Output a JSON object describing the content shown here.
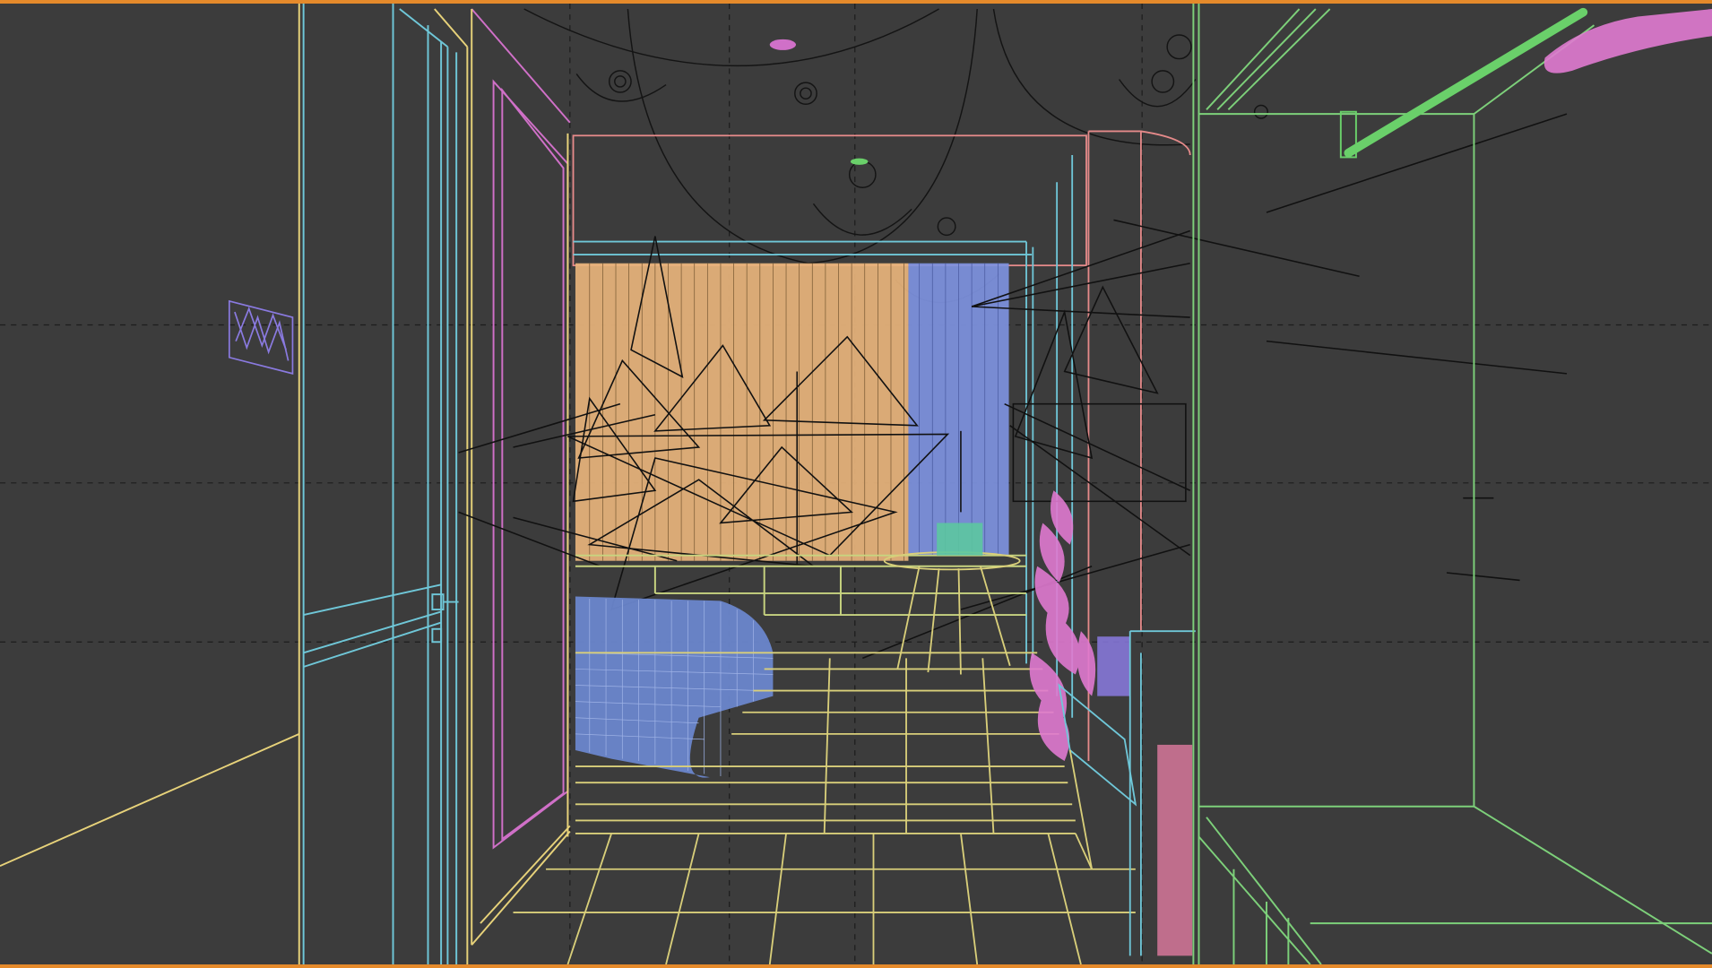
{
  "viewport": {
    "active_border_color": "#e58a2b",
    "background_color": "#3c3c3c",
    "display_mode": "wireframe",
    "grid_visible": true,
    "object_colors": {
      "ceiling_lines": "#1a1a1a",
      "left_wall": "#e7d27a",
      "door_frame": "#6fc7d8",
      "door_panel_trim": "#d070c8",
      "curtain_left": "#e8b47c",
      "curtain_right": "#7e92e0",
      "bed": "#6a86cc",
      "floor_tiles": "#d9cf7a",
      "plant": "#e07ad0",
      "right_wall": "#7dd07a",
      "rod": "#6ad06a",
      "towel": "#e07ad0",
      "tv_cabinet": "#e07aa0"
    }
  }
}
